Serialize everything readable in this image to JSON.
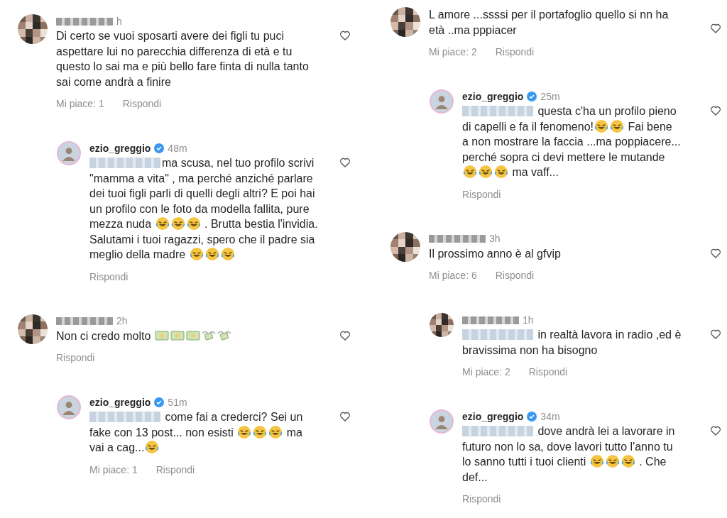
{
  "columns": [
    {
      "comments": [
        {
          "reply": false,
          "avatar": {
            "kind": "pixelated"
          },
          "username_blurred": true,
          "verified": false,
          "time": "h",
          "body": [
            {
              "kind": "text",
              "text": "Di certo se vuoi sposarti avere dei figli tu puci aspettare lui no parecchia differenza di età e tu questo lo sai ma e più bello fare finta di nulla tanto sai come andrà a finire"
            }
          ],
          "likes": "Mi piace: 1",
          "reply_label": "Rispondi"
        },
        {
          "reply": true,
          "avatar": {
            "kind": "profile"
          },
          "username": "ezio_greggio",
          "verified": true,
          "time": "48m",
          "body": [
            {
              "kind": "mention"
            },
            {
              "kind": "text",
              "text": "ma scusa, nel tuo profilo scrivi \"mamma a vita\" , ma perché anziché parlare dei tuoi figli parli di quelli degli altri? E poi hai un profilo con le foto da modella fallita, pure mezza nuda "
            },
            {
              "kind": "laugh"
            },
            {
              "kind": "laugh"
            },
            {
              "kind": "laugh"
            },
            {
              "kind": "text",
              "text": " . Brutta bestia l'invidia. Salutami i tuoi ragazzi, spero che il padre sia meglio della madre "
            },
            {
              "kind": "laugh"
            },
            {
              "kind": "laugh"
            },
            {
              "kind": "laugh"
            }
          ],
          "reply_label": "Rispondi"
        },
        {
          "reply": false,
          "avatar": {
            "kind": "pixelated"
          },
          "username_blurred": true,
          "verified": false,
          "time": "2h",
          "body": [
            {
              "kind": "text",
              "text": "Non ci credo molto "
            },
            {
              "kind": "money"
            },
            {
              "kind": "money"
            },
            {
              "kind": "money"
            },
            {
              "kind": "money-wings"
            },
            {
              "kind": "money-wings"
            }
          ],
          "reply_label": "Rispondi"
        },
        {
          "reply": true,
          "avatar": {
            "kind": "profile"
          },
          "username": "ezio_greggio",
          "verified": true,
          "time": "51m",
          "body": [
            {
              "kind": "mention"
            },
            {
              "kind": "text",
              "text": " come fai a crederci? Sei un fake con 13 post... non esisti "
            },
            {
              "kind": "laugh"
            },
            {
              "kind": "laugh"
            },
            {
              "kind": "laugh"
            },
            {
              "kind": "text",
              "text": " ma vai a cag..."
            },
            {
              "kind": "laugh"
            }
          ],
          "likes": "Mi piace: 1",
          "reply_label": "Rispondi"
        }
      ]
    },
    {
      "comments": [
        {
          "reply": false,
          "avatar": {
            "kind": "pixelated"
          },
          "verified": false,
          "body": [
            {
              "kind": "text",
              "text": "L amore ...ssssi per il portafoglio quello si nn ha età ..ma pppiacer"
            }
          ],
          "likes": "Mi piace: 2",
          "reply_label": "Rispondi"
        },
        {
          "reply": true,
          "avatar": {
            "kind": "profile"
          },
          "username": "ezio_greggio",
          "verified": true,
          "time": "25m",
          "body": [
            {
              "kind": "mention"
            },
            {
              "kind": "text",
              "text": " questa c'ha un profilo pieno di capelli e fa il fenomeno!"
            },
            {
              "kind": "laugh"
            },
            {
              "kind": "laugh"
            },
            {
              "kind": "text",
              "text": " Fai bene a non mostrare la faccia ...ma poppiacere... perché sopra ci devi mettere le mutande "
            },
            {
              "kind": "laugh"
            },
            {
              "kind": "laugh"
            },
            {
              "kind": "laugh"
            },
            {
              "kind": "text",
              "text": " ma vaff..."
            }
          ],
          "reply_label": "Rispondi"
        },
        {
          "reply": false,
          "avatar": {
            "kind": "pixelated"
          },
          "username_blurred": true,
          "verified": false,
          "time": "3h",
          "body": [
            {
              "kind": "text",
              "text": "Il prossimo anno è al gfvip"
            }
          ],
          "likes": "Mi piace: 6",
          "reply_label": "Rispondi"
        },
        {
          "reply": true,
          "avatar": {
            "kind": "pixelated"
          },
          "username_blurred": true,
          "verified": false,
          "time": "1h",
          "body": [
            {
              "kind": "mention"
            },
            {
              "kind": "text",
              "text": " in realtà lavora in radio ,ed è bravissima non ha bisogno"
            }
          ],
          "likes": "Mi piace: 2",
          "reply_label": "Rispondi"
        },
        {
          "reply": true,
          "avatar": {
            "kind": "profile"
          },
          "username": "ezio_greggio",
          "verified": true,
          "time": "34m",
          "body": [
            {
              "kind": "mention"
            },
            {
              "kind": "text",
              "text": " dove andrà lei a lavorare in futuro non lo sa, dove lavori tutto l'anno tu lo sanno tutti i tuoi clienti "
            },
            {
              "kind": "laugh"
            },
            {
              "kind": "laugh"
            },
            {
              "kind": "laugh"
            },
            {
              "kind": "text",
              "text": " . Che def..."
            }
          ],
          "reply_label": "Rispondi"
        }
      ]
    }
  ]
}
